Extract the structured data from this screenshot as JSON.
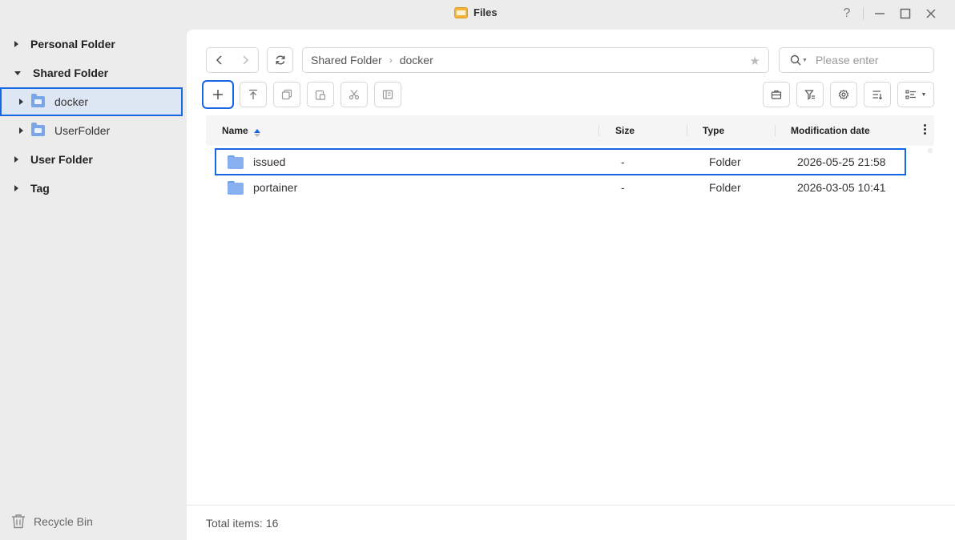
{
  "window": {
    "title": "Files",
    "buttons": [
      "help",
      "minimize",
      "maximize",
      "close"
    ]
  },
  "sidebar": {
    "personal_folder": "Personal Folder",
    "shared_folder": "Shared Folder",
    "shared_children": [
      {
        "label": "docker",
        "selected": true
      },
      {
        "label": "UserFolder",
        "selected": false
      }
    ],
    "user_folder": "User Folder",
    "tag": "Tag",
    "recycle_bin": "Recycle Bin"
  },
  "toolbar": {
    "breadcrumb": [
      "Shared Folder",
      "docker"
    ],
    "search_placeholder": "Please enter",
    "action_icons": [
      "plus-icon",
      "upload-icon",
      "copy-icon",
      "paste-icon",
      "cut-icon",
      "properties-icon"
    ],
    "right_icons": [
      "briefcase-icon",
      "filter-icon",
      "settings-icon",
      "sort-icon",
      "view-list-icon"
    ]
  },
  "table": {
    "columns": {
      "name": "Name",
      "size": "Size",
      "type": "Type",
      "modified": "Modification date"
    },
    "rows": [
      {
        "name": "issued",
        "size": "-",
        "type": "Folder",
        "modified": "2026-05-25 21:58",
        "selected": true
      },
      {
        "name": "portainer",
        "size": "-",
        "type": "Folder",
        "modified": "2026-03-05 10:41",
        "selected": false
      }
    ]
  },
  "footer": {
    "total_label": "Total items:",
    "total_count": "16"
  },
  "colors": {
    "accent": "#1766e6",
    "selection_bg": "#dde6f3",
    "folder": "#86b0ef",
    "app_icon": "#f5b73b"
  }
}
